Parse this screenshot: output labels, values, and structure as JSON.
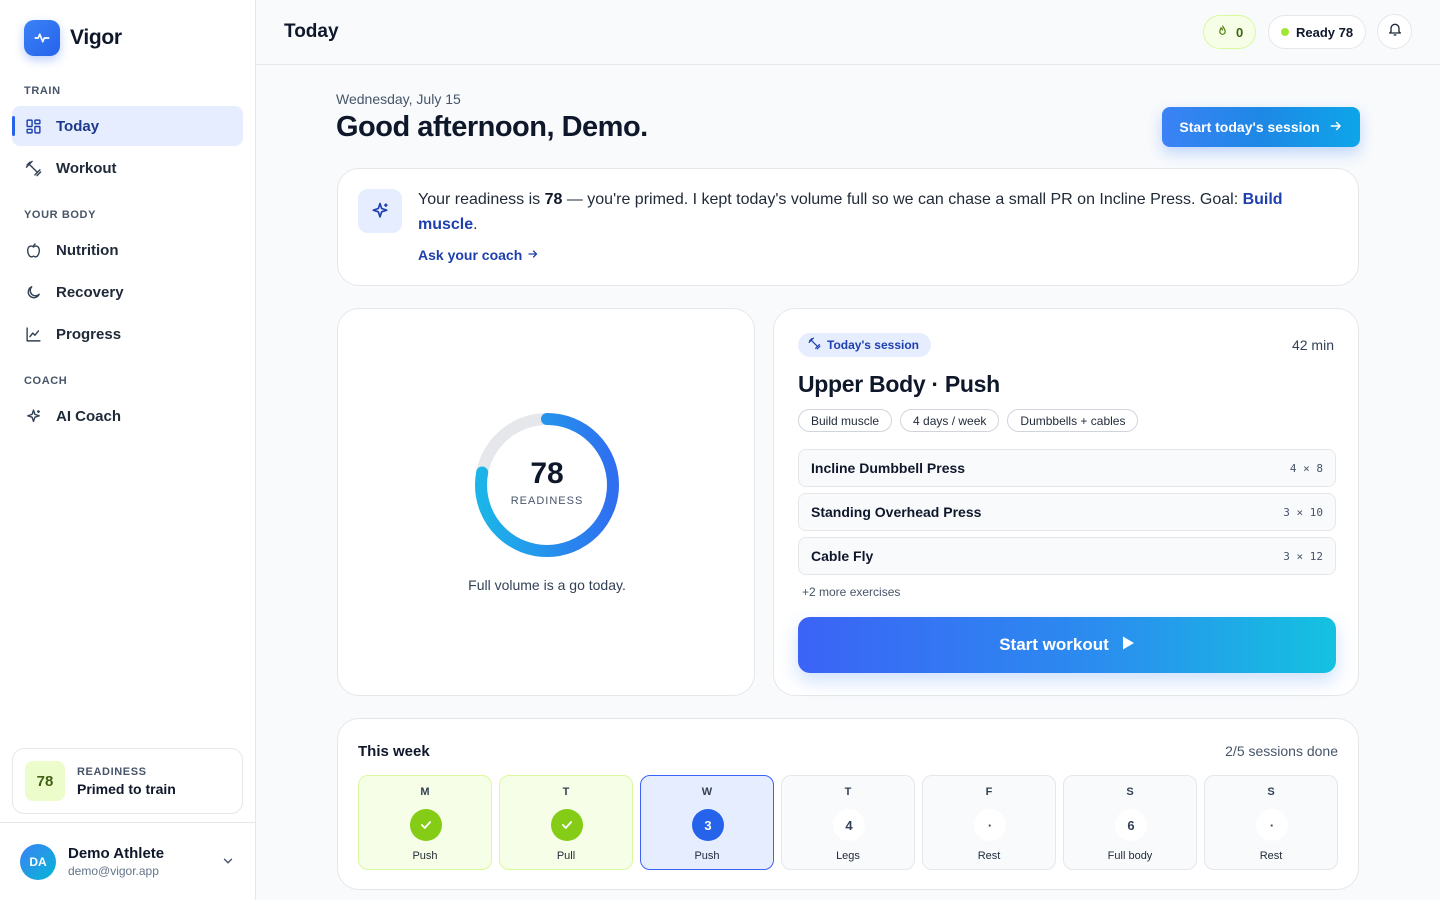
{
  "app": {
    "name": "Vigor"
  },
  "sidebar": {
    "sections": [
      {
        "title": "TRAIN"
      },
      {
        "title": "YOUR BODY"
      },
      {
        "title": "COACH"
      }
    ],
    "items": [
      {
        "label": "Today",
        "icon": "grid-icon",
        "active": true
      },
      {
        "label": "Workout",
        "icon": "dumbbell-icon"
      },
      {
        "label": "Nutrition",
        "icon": "apple-icon"
      },
      {
        "label": "Recovery",
        "icon": "moon-icon"
      },
      {
        "label": "Progress",
        "icon": "chart-line-icon"
      },
      {
        "label": "AI Coach",
        "icon": "sparkle-icon"
      }
    ],
    "readiness_card": {
      "score": "78",
      "title": "READINESS",
      "status": "Primed to train"
    },
    "user": {
      "initials": "DA",
      "name": "Demo Athlete",
      "email": "demo@vigor.app"
    }
  },
  "topbar": {
    "title": "Today",
    "streak": "0",
    "ready_label": "Ready 78"
  },
  "header": {
    "date": "Wednesday, July 15",
    "greeting": "Good afternoon, Demo.",
    "cta": "Start today's session"
  },
  "coach": {
    "text_pre": "Your readiness is ",
    "score": "78",
    "text_post": " — you're primed. I kept today's volume full so we can chase a small PR on Incline Press. Goal: ",
    "goal": "Build muscle",
    "text_end": ".",
    "ask": "Ask your coach"
  },
  "readiness": {
    "score": "78",
    "label": "READINESS",
    "fraction": 0.78,
    "caption": "Full volume is a go today."
  },
  "session": {
    "tag": "Today's session",
    "duration": "42 min",
    "title": "Upper Body · Push",
    "chips": [
      "Build muscle",
      "4 days / week",
      "Dumbbells + cables"
    ],
    "exercises": [
      {
        "name": "Incline Dumbbell Press",
        "sets": "4 × 8"
      },
      {
        "name": "Standing Overhead Press",
        "sets": "3 × 10"
      },
      {
        "name": "Cable Fly",
        "sets": "3 × 12"
      }
    ],
    "more": "+2 more exercises",
    "start": "Start workout"
  },
  "week": {
    "title": "This week",
    "summary": "2/5 sessions done",
    "days": [
      {
        "letter": "M",
        "mark": "",
        "label": "Push",
        "state": "done"
      },
      {
        "letter": "T",
        "mark": "",
        "label": "Pull",
        "state": "done"
      },
      {
        "letter": "W",
        "mark": "3",
        "label": "Push",
        "state": "today"
      },
      {
        "letter": "T",
        "mark": "4",
        "label": "Legs",
        "state": "upcoming"
      },
      {
        "letter": "F",
        "mark": "·",
        "label": "Rest",
        "state": "rest"
      },
      {
        "letter": "S",
        "mark": "6",
        "label": "Full body",
        "state": "upcoming"
      },
      {
        "letter": "S",
        "mark": "·",
        "label": "Rest",
        "state": "rest"
      }
    ]
  },
  "colors": {
    "accent": "#2563eb",
    "lime": "#84cc16",
    "ring_track": "#e5e7eb"
  }
}
